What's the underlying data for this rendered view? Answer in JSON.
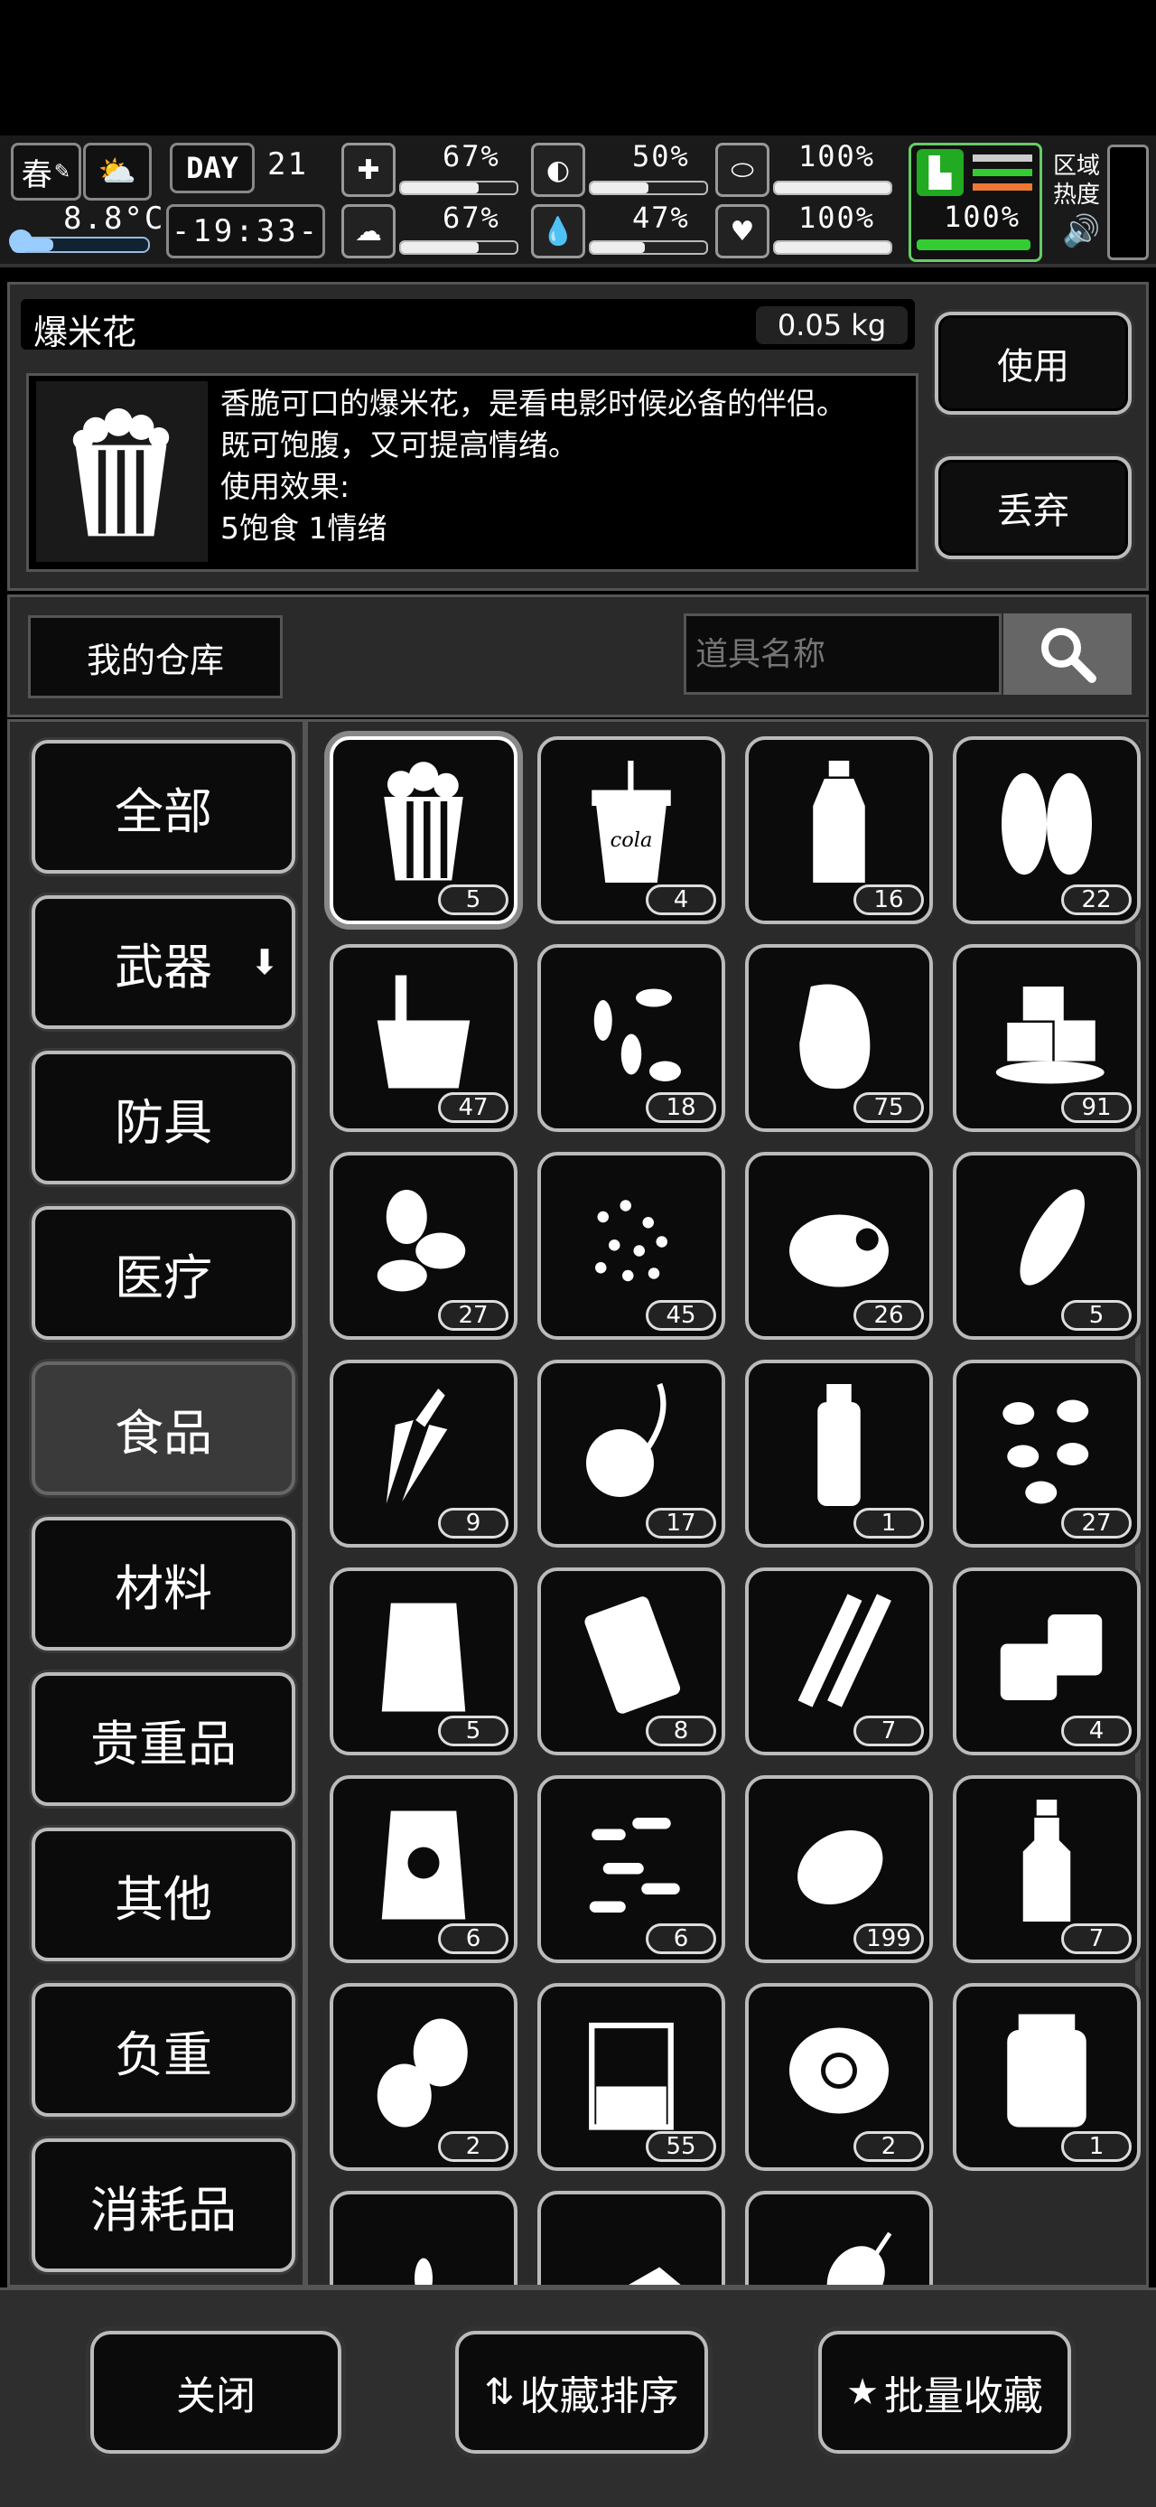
{
  "hud": {
    "season": "春",
    "temperature": "8.8°C",
    "day_label": "DAY",
    "day_number": "21",
    "clock": "-19:33-",
    "stats": [
      {
        "name": "health",
        "value": "67%",
        "level": 0.67
      },
      {
        "name": "hunger",
        "value": "50%",
        "level": 0.5
      },
      {
        "name": "energy",
        "value": "100%",
        "level": 1.0
      },
      {
        "name": "sanity",
        "value": "67%",
        "level": 0.67
      },
      {
        "name": "thirst",
        "value": "47%",
        "level": 0.47
      },
      {
        "name": "mood",
        "value": "100%",
        "level": 1.0
      }
    ],
    "stamina": {
      "value": "100%",
      "level": 1.0
    },
    "area_heat_label_1": "区域",
    "area_heat_label_2": "热度"
  },
  "item_detail": {
    "name": "爆米花",
    "weight": "0.05 kg",
    "description_1": "香脆可口的爆米花，是看电影时候必备的伴侣。",
    "description_2": "既可饱腹，又可提高情绪。",
    "effect_label": "使用效果:",
    "effect_value": "5饱食 1情绪",
    "use_button": "使用",
    "discard_button": "丢弃"
  },
  "warehouse": {
    "title": "我的仓库",
    "search_placeholder": "道具名称"
  },
  "categories": [
    {
      "label": "全部"
    },
    {
      "label": "武器"
    },
    {
      "label": "防具"
    },
    {
      "label": "医疗"
    },
    {
      "label": "食品",
      "active": true
    },
    {
      "label": "材料"
    },
    {
      "label": "贵重品"
    },
    {
      "label": "其他"
    },
    {
      "label": "负重"
    },
    {
      "label": "消耗品"
    }
  ],
  "items": [
    {
      "icon": "popcorn-icon",
      "count": "5",
      "selected": true
    },
    {
      "icon": "cola-cup-icon",
      "count": "4"
    },
    {
      "icon": "water-bottle-icon",
      "count": "16"
    },
    {
      "icon": "leaves-icon",
      "count": "22"
    },
    {
      "icon": "ice-bucket-icon",
      "count": "47"
    },
    {
      "icon": "seeds-icon",
      "count": "18"
    },
    {
      "icon": "raw-meat-icon",
      "count": "75"
    },
    {
      "icon": "ice-cubes-icon",
      "count": "91"
    },
    {
      "icon": "nuts-icon",
      "count": "27"
    },
    {
      "icon": "grain-seeds-icon",
      "count": "45"
    },
    {
      "icon": "bread-icon",
      "count": "26"
    },
    {
      "icon": "corn-icon",
      "count": "5"
    },
    {
      "icon": "carrot-icon",
      "count": "9"
    },
    {
      "icon": "turnip-icon",
      "count": "17"
    },
    {
      "icon": "sauce-bottle-icon",
      "count": "1"
    },
    {
      "icon": "beans-icon",
      "count": "27"
    },
    {
      "icon": "flour-bag-icon",
      "count": "5"
    },
    {
      "icon": "snack-bag-icon",
      "count": "8"
    },
    {
      "icon": "stick-snack-icon",
      "count": "7"
    },
    {
      "icon": "canned-food-icon",
      "count": "4"
    },
    {
      "icon": "meat-bag-icon",
      "count": "6"
    },
    {
      "icon": "bone-biscuit-icon",
      "count": "6"
    },
    {
      "icon": "potato-icon",
      "count": "199"
    },
    {
      "icon": "oil-bottle-icon",
      "count": "7"
    },
    {
      "icon": "eggs-icon",
      "count": "2"
    },
    {
      "icon": "measuring-cup-icon",
      "count": "55"
    },
    {
      "icon": "fried-egg-icon",
      "count": "2"
    },
    {
      "icon": "pickle-jar-icon",
      "count": "1"
    },
    {
      "icon": "wheat-icon",
      "count": ""
    },
    {
      "icon": "tofu-icon",
      "count": ""
    },
    {
      "icon": "skewer-icon",
      "count": ""
    }
  ],
  "bottom": {
    "close_button": "关闭",
    "sort_button": "收藏排序",
    "batch_button": "批量收藏"
  }
}
